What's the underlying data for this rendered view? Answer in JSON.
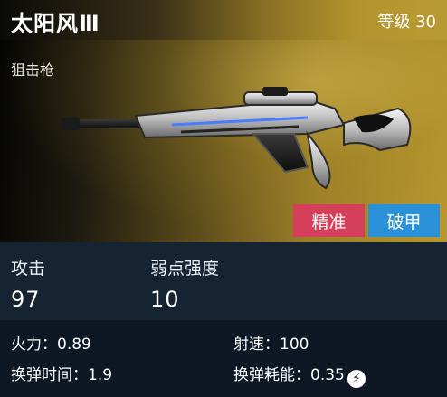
{
  "weapon": {
    "name": "太阳风Ⅲ",
    "level": "等级 30",
    "category": "狙击枪",
    "tags": [
      "精准",
      "破甲"
    ]
  },
  "primary_stats": [
    {
      "label": "攻击",
      "value": "97"
    },
    {
      "label": "弱点强度",
      "value": "10"
    }
  ],
  "secondary_stats": [
    {
      "label": "火力：",
      "value": "0.89"
    },
    {
      "label": "射速：",
      "value": "100"
    },
    {
      "label": "换弹时间：",
      "value": "1.9"
    },
    {
      "label": "换弹耗能：",
      "value": "0.35"
    }
  ],
  "icons": {
    "energy": "lightning-bolt-icon"
  },
  "colors": {
    "precise": "#d4405a",
    "pierce": "#2a90d8",
    "header_gold": "#b89a32"
  }
}
